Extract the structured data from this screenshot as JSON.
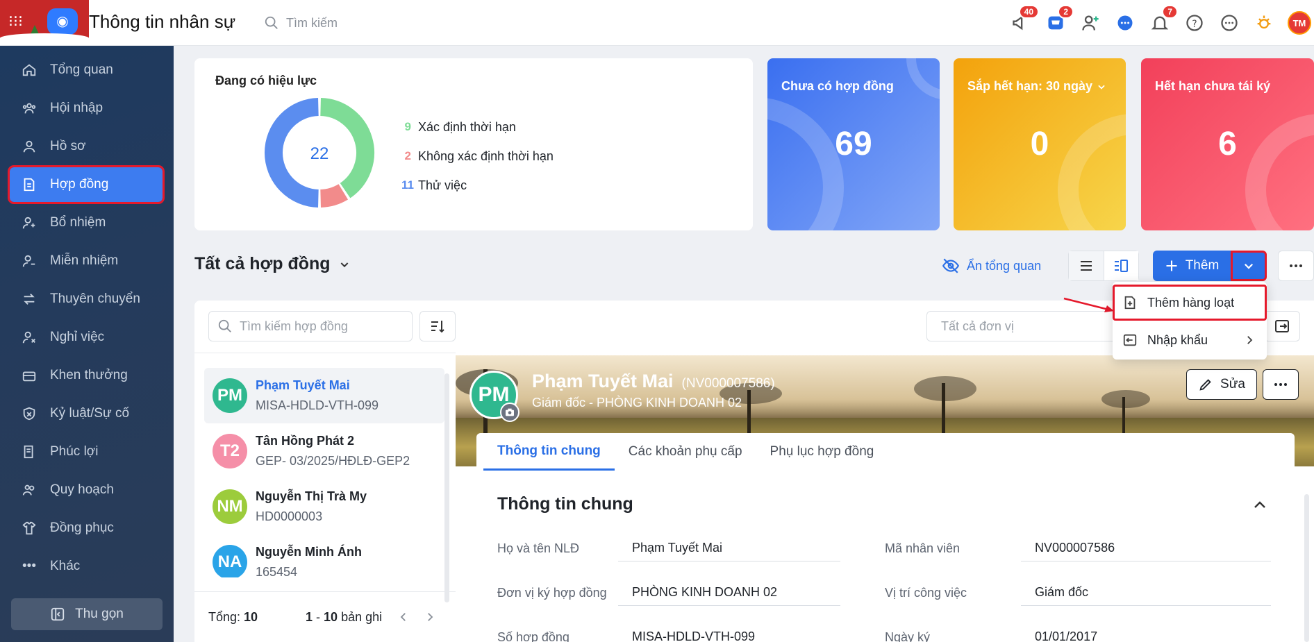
{
  "header": {
    "app_title": "Thông tin nhân sự",
    "search_placeholder": "Tìm kiếm",
    "badges": {
      "announcements": "40",
      "store": "2",
      "notifications": "7"
    },
    "avatar_initials": "TM"
  },
  "sidebar": {
    "items": [
      {
        "label": "Tổng quan",
        "icon": "home-icon"
      },
      {
        "label": "Hội nhập",
        "icon": "onboarding-icon"
      },
      {
        "label": "Hồ sơ",
        "icon": "profile-icon"
      },
      {
        "label": "Hợp đồng",
        "icon": "contract-icon",
        "active": true
      },
      {
        "label": "Bổ nhiệm",
        "icon": "appoint-icon"
      },
      {
        "label": "Miễn nhiệm",
        "icon": "dismiss-icon"
      },
      {
        "label": "Thuyên chuyển",
        "icon": "transfer-icon"
      },
      {
        "label": "Nghỉ việc",
        "icon": "resign-icon"
      },
      {
        "label": "Khen thưởng",
        "icon": "reward-icon"
      },
      {
        "label": "Kỷ luật/Sự cố",
        "icon": "discipline-icon"
      },
      {
        "label": "Phúc lợi",
        "icon": "benefit-icon"
      },
      {
        "label": "Quy hoạch",
        "icon": "planning-icon"
      },
      {
        "label": "Đồng phục",
        "icon": "uniform-icon"
      },
      {
        "label": "Khác",
        "icon": "more-dots-icon"
      }
    ],
    "collapse_label": "Thu gọn"
  },
  "summary": {
    "title": "Đang có hiệu lực",
    "total": "22",
    "legend": [
      {
        "count": "9",
        "label": "Xác định thời hạn",
        "color": "#7edc96"
      },
      {
        "count": "2",
        "label": "Không xác định thời hạn",
        "color": "#f28b8b"
      },
      {
        "count": "11",
        "label": "Thử việc",
        "color": "#5b8def"
      }
    ]
  },
  "stat_cards": [
    {
      "label": "Chưa có hợp đồng",
      "value": "69"
    },
    {
      "label": "Sắp hết hạn: 30 ngày",
      "value": "0"
    },
    {
      "label": "Hết hạn chưa tái ký",
      "value": "6"
    }
  ],
  "list_header": {
    "title": "Tất cả hợp đồng",
    "hide_overview": "Ẩn tổng quan",
    "add_label": "Thêm"
  },
  "dropdown": {
    "items": [
      "Thêm hàng loạt",
      "Nhập khẩu"
    ]
  },
  "filters": {
    "search_placeholder": "Tìm kiếm hợp đồng",
    "unit_placeholder": "Tất cả đơn vị"
  },
  "employees": [
    {
      "initials": "PM",
      "name": "Phạm Tuyết Mai",
      "code": "MISA-HDLD-VTH-099",
      "color": "#2fb88f"
    },
    {
      "initials": "T2",
      "name": "Tân Hồng Phát 2",
      "code": "GEP- 03/2025/HĐLĐ-GEP2",
      "color": "#f58fa8"
    },
    {
      "initials": "NM",
      "name": "Nguyễn Thị Trà My",
      "code": "HD0000003",
      "color": "#9ccc3c"
    },
    {
      "initials": "NA",
      "name": "Nguyễn Minh Ánh",
      "code": "165454",
      "color": "#2aa4e8"
    }
  ],
  "footer": {
    "total_label": "Tổng:",
    "total_value": "10",
    "range_start": "1",
    "range_sep": "-",
    "range_end": "10",
    "range_suffix": "bản ghi"
  },
  "detail": {
    "initials": "PM",
    "name": "Phạm Tuyết Mai",
    "code": "(NV000007586)",
    "role": "Giám đốc - PHÒNG KINH DOANH 02",
    "edit_label": "Sửa",
    "tabs": [
      "Thông tin chung",
      "Các khoản phụ cấp",
      "Phụ lục hợp đồng"
    ],
    "section_title": "Thông tin chung",
    "fields": [
      {
        "label": "Họ và tên NLĐ",
        "value": "Phạm Tuyết Mai"
      },
      {
        "label": "Mã nhân viên",
        "value": "NV000007586"
      },
      {
        "label": "Đơn vị ký hợp đồng",
        "value": "PHÒNG KINH DOANH 02"
      },
      {
        "label": "Vị trí công việc",
        "value": "Giám đốc"
      },
      {
        "label": "Số hợp đồng",
        "value": "MISA-HDLD-VTH-099"
      },
      {
        "label": "Ngày ký",
        "value": "01/01/2017"
      }
    ]
  }
}
